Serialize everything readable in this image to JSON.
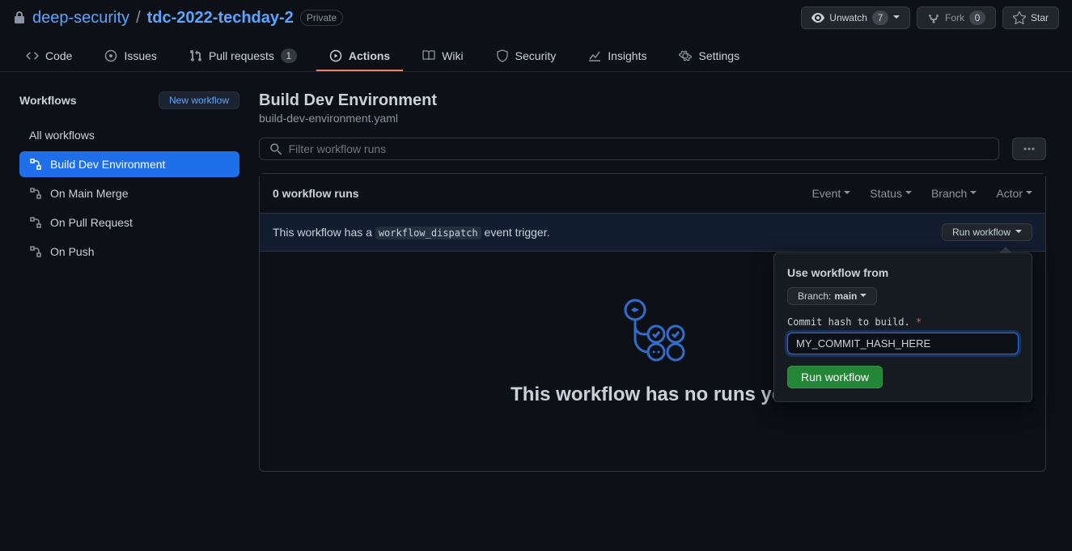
{
  "repo": {
    "owner": "deep-security",
    "name": "tdc-2022-techday-2",
    "visibility": "Private"
  },
  "header_actions": {
    "unwatch": "Unwatch",
    "unwatch_count": "7",
    "fork": "Fork",
    "fork_count": "0",
    "star": "Star"
  },
  "tabs": {
    "code": "Code",
    "issues": "Issues",
    "pulls": "Pull requests",
    "pulls_count": "1",
    "actions": "Actions",
    "wiki": "Wiki",
    "security": "Security",
    "insights": "Insights",
    "settings": "Settings"
  },
  "sidebar": {
    "title": "Workflows",
    "new": "New workflow",
    "items": [
      {
        "label": "All workflows"
      },
      {
        "label": "Build Dev Environment"
      },
      {
        "label": "On Main Merge"
      },
      {
        "label": "On Pull Request"
      },
      {
        "label": "On Push"
      }
    ]
  },
  "page": {
    "title": "Build Dev Environment",
    "yaml": "build-dev-environment.yaml",
    "filter_placeholder": "Filter workflow runs",
    "runs_count": "0 workflow runs",
    "filters": {
      "event": "Event",
      "status": "Status",
      "branch": "Branch",
      "actor": "Actor"
    },
    "dispatch_pre": "This workflow has a ",
    "dispatch_code": "workflow_dispatch",
    "dispatch_post": " event trigger.",
    "run_btn": "Run workflow",
    "empty": "This workflow has no runs yet."
  },
  "popover": {
    "use_from": "Use workflow from",
    "branch_label": "Branch: ",
    "branch_value": "main",
    "input_label": "Commit hash to build.",
    "required": "*",
    "input_value": "MY_COMMIT_HASH_HERE",
    "submit": "Run workflow"
  }
}
